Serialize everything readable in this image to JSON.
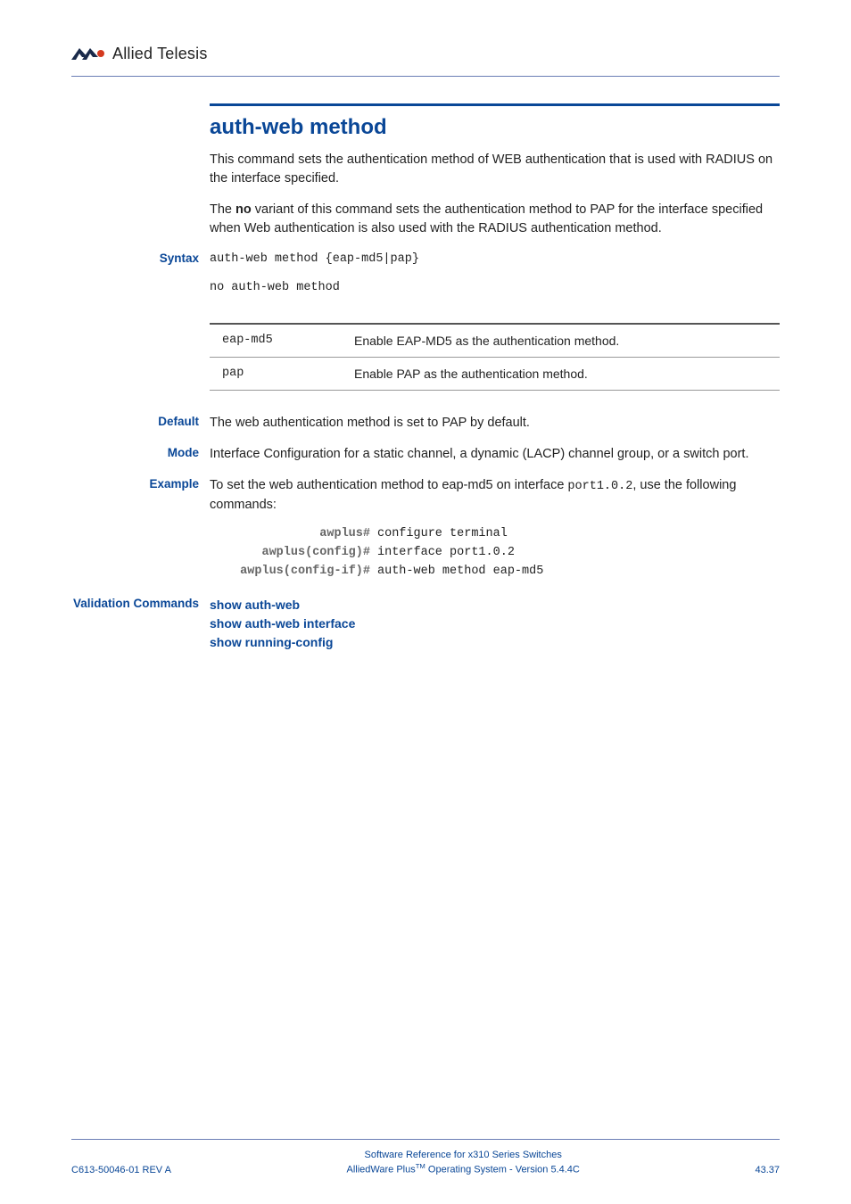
{
  "header": {
    "logo_text": "Allied Telesis"
  },
  "title": "auth-web method",
  "intro_p1": "This command sets the authentication method of WEB authentication that is used with RADIUS on the interface specified.",
  "intro_p2_prefix": "The ",
  "intro_p2_bold": "no",
  "intro_p2_suffix": " variant of this command sets the authentication method to PAP for the interface specified when Web authentication is also used with the RADIUS authentication method.",
  "labels": {
    "syntax": "Syntax",
    "default": "Default",
    "mode": "Mode",
    "example": "Example",
    "validation": "Validation Commands"
  },
  "syntax": {
    "line1": "auth-web method {eap-md5|pap}",
    "line2": "no auth-web method"
  },
  "params": [
    {
      "name": "eap-md5",
      "desc": "Enable EAP-MD5 as the authentication method."
    },
    {
      "name": "pap",
      "desc": "Enable PAP as the authentication method."
    }
  ],
  "default_text": "The web authentication method is set to PAP by default.",
  "mode_text": "Interface Configuration for a static channel, a dynamic (LACP) channel group, or a switch port.",
  "example_prefix": "To set the web authentication method to eap-md5 on interface ",
  "example_iface": "port1.0.2",
  "example_suffix": ", use the following commands:",
  "cmd": [
    {
      "prompt": "awplus#",
      "text": "configure terminal"
    },
    {
      "prompt": "awplus(config)#",
      "text": "interface port1.0.2"
    },
    {
      "prompt": "awplus(config-if)#",
      "text": "auth-web method eap-md5"
    }
  ],
  "validation_links": [
    "show auth-web",
    "show auth-web interface",
    "show running-config"
  ],
  "footer": {
    "left": "C613-50046-01 REV A",
    "center1": "Software Reference for x310 Series Switches",
    "center2_prefix": "AlliedWare Plus",
    "center2_tm": "TM",
    "center2_suffix": " Operating System - Version 5.4.4C",
    "right": "43.37"
  }
}
